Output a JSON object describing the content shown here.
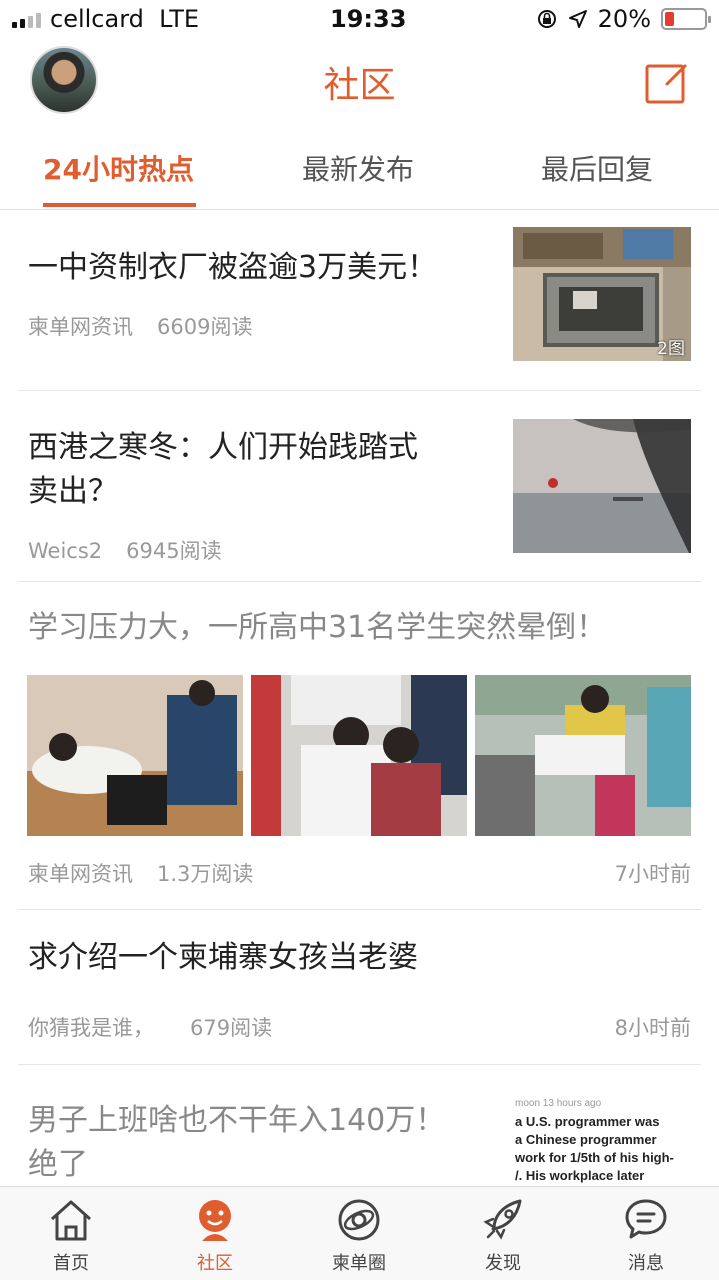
{
  "status_bar": {
    "carrier": "cellcard",
    "network": "LTE",
    "time": "19:33",
    "battery": "20%",
    "battery_level": 0.2
  },
  "header": {
    "title": "社区",
    "compose_icon": "compose-icon"
  },
  "tabs": [
    {
      "label": "24小时热点",
      "active": true
    },
    {
      "label": "最新发布",
      "active": false
    },
    {
      "label": "最后回复",
      "active": false
    }
  ],
  "feed": [
    {
      "title": "一中资制衣厂被盗逾3万美元！",
      "source": "柬单网资讯",
      "reads": "6609阅读",
      "image_badge": "2图"
    },
    {
      "title_line1": "西港之寒冬：人们开始践踏式",
      "title_line2": "卖出？",
      "source": "Weics2",
      "reads": "6945阅读"
    },
    {
      "title": "学习压力大，一所高中31名学生突然晕倒！",
      "source": "柬单网资讯",
      "reads": "1.3万阅读",
      "time": "7小时前"
    },
    {
      "title": "求介绍一个柬埔寨女孩当老婆",
      "source": "你猜我是谁，",
      "reads": "679阅读",
      "time": "8小时前"
    },
    {
      "title_line1": "男子上班啥也不干年入140万！",
      "title_line2": "绝了",
      "thumb_text": {
        "line0": "moon 13 hours ago",
        "line1": "a U.S. programmer was",
        "line2": "a Chinese programmer",
        "line3": "work for 1/5th of his high-",
        "line4": "/. His workplace later"
      }
    }
  ],
  "tabbar": [
    {
      "label": "首页",
      "icon": "home-icon"
    },
    {
      "label": "社区",
      "icon": "community-icon",
      "active": true
    },
    {
      "label": "柬单圈",
      "icon": "planet-icon"
    },
    {
      "label": "发现",
      "icon": "rocket-icon"
    },
    {
      "label": "消息",
      "icon": "chat-bubble-icon"
    }
  ],
  "colors": {
    "accent": "#e05d2f",
    "text": "#222222",
    "meta": "#999999"
  }
}
